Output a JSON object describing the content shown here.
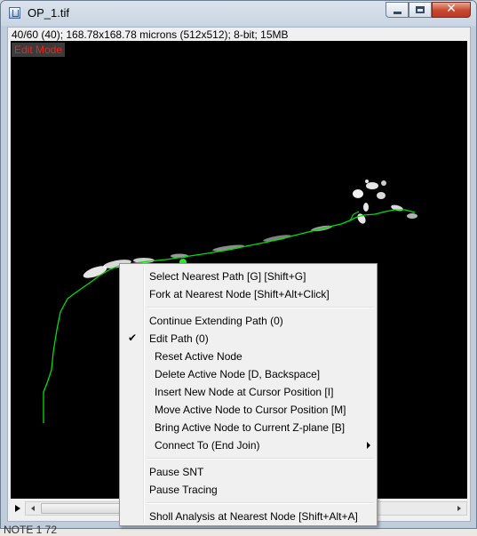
{
  "window": {
    "title": "OP_1.tif",
    "icon": "imagej-image-icon",
    "controls": [
      "minimize-icon",
      "maximize-icon",
      "close-icon"
    ],
    "close_glyph": "✕"
  },
  "image": {
    "info": "40/60 (40); 168.78x168.78 microns (512x512); 8-bit; 15MB",
    "mode_label": "Edit Mode",
    "mode_color": "#e8251b",
    "trace_color": "#00e000"
  },
  "scrollbar": {
    "play_icon": "play-icon"
  },
  "background_text": "NOTE 1 72",
  "context_menu": {
    "items": [
      {
        "label": "Select Nearest Path  [G] [Shift+G]"
      },
      {
        "label": "Fork at Nearest Node  [Shift+Alt+Click]"
      },
      {
        "label": "Continue Extending Path (0)"
      },
      {
        "label": "Edit Path (0)",
        "checked": true,
        "check_glyph": "✔"
      },
      {
        "label": "Reset Active Node"
      },
      {
        "label": "Delete Active Node  [D, Backspace]"
      },
      {
        "label": "Insert New Node at Cursor Position  [I]"
      },
      {
        "label": "Move Active Node to Cursor Position  [M]"
      },
      {
        "label": "Bring Active Node to Current Z-plane  [B]"
      },
      {
        "label": "Connect To (End Join)",
        "submenu": true
      },
      {
        "label": "Pause SNT"
      },
      {
        "label": "Pause Tracing"
      },
      {
        "label": "Sholl Analysis at Nearest Node  [Shift+Alt+A]"
      }
    ]
  }
}
